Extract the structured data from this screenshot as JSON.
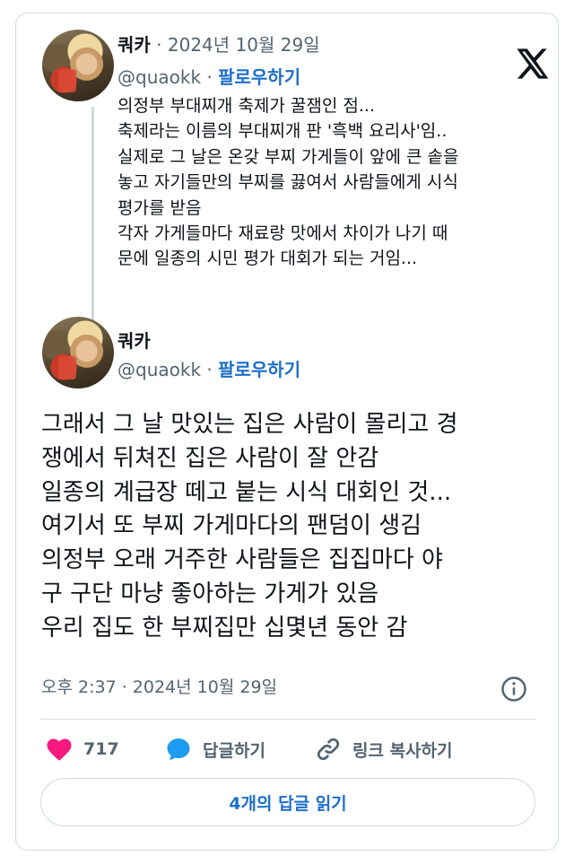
{
  "quoted_tweet": {
    "author_name": "쿼카",
    "date": "· 2024년 10월 29일",
    "handle": "@quaokk",
    "separator": "·",
    "follow_label": "팔로우하기",
    "lines": [
      "의정부 부대찌개 축제가 꿀잼인 점...",
      "축제라는 이름의 부대찌개 판 '흑백 요리사'임..",
      "실제로 그 날은 온갖 부찌 가게들이 앞에 큰 솥을",
      "놓고 자기들만의 부찌를 끓여서 사람들에게 시식",
      "평가를 받음",
      "각자 가게들마다 재료랑 맛에서 차이가 나기 때",
      "문에 일종의 시민 평가 대회가 되는 거임..."
    ]
  },
  "main_tweet": {
    "author_name": "쿼카",
    "handle": "@quaokk",
    "separator": "·",
    "follow_label": "팔로우하기",
    "lines": [
      "그래서 그 날 맛있는 집은 사람이 몰리고 경",
      "쟁에서 뒤쳐진 집은 사람이 잘 안감",
      "일종의 계급장 떼고 붙는 시식 대회인 것...",
      "여기서 또 부찌 가게마다의 팬덤이 생김",
      "의정부 오래 거주한 사람들은 집집마다 야",
      "구 구단 마냥 좋아하는 가게가 있음",
      "우리 집도 한 부찌집만 십몇년 동안 감"
    ],
    "timestamp": "오후 2:37 · 2024년 10월 29일"
  },
  "actions": {
    "like_count": "717",
    "reply_label": "답글하기",
    "copy_link_label": "링크 복사하기"
  },
  "read_replies_label": "4개의 답글 읽기",
  "icons": [
    "x-logo-icon",
    "info-icon",
    "heart-icon",
    "speech-bubble-icon",
    "link-icon"
  ],
  "colors": {
    "heart": "#f91880",
    "reply": "#1d9bf0",
    "follow": "#1d6fc9",
    "muted": "#536471",
    "border": "#cfd9de"
  }
}
